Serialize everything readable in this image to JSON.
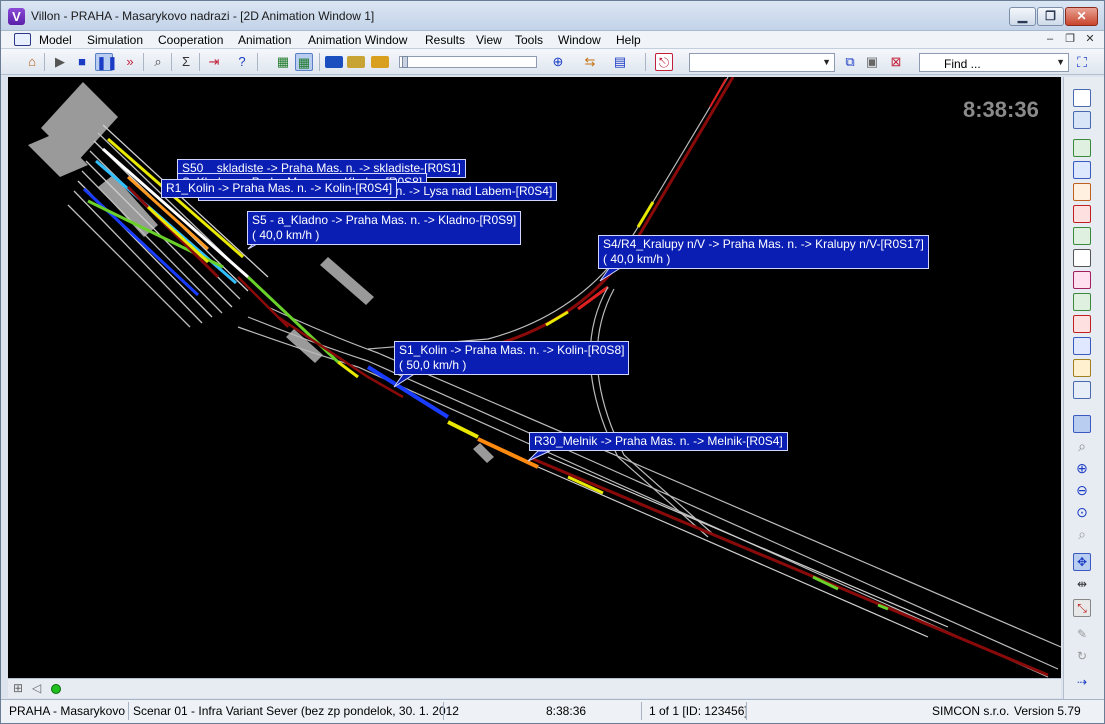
{
  "window": {
    "title": "Villon - PRAHA - Masarykovo nadrazi - [2D Animation Window 1]",
    "app_icon_letter": "V"
  },
  "menu": {
    "items": [
      "Model",
      "Simulation",
      "Cooperation",
      "Animation",
      "Animation Window",
      "Results",
      "View",
      "Tools",
      "Window",
      "Help"
    ]
  },
  "toolbar": {
    "find_placeholder": "Find ...",
    "combo_value": ""
  },
  "canvas": {
    "clock": "8:38:36",
    "background": "#000000",
    "label_color": "#0a1eb3",
    "train_labels": [
      {
        "text": "S50 _ skladiste -> Praha Mas. n. -> skladiste-[R0S1]",
        "speed": ""
      },
      {
        "text": "S_Kladno -> Praha Mas. n. -> Kladno-[R0S8]",
        "speed": ""
      },
      {
        "text": "Os_Lysa nad Labem -> Praha Mas. n. -> Lysa nad Labem-[R0S4]",
        "speed": ""
      },
      {
        "text": "R1_Kolin -> Praha Mas. n. -> Kolin-[R0S4]",
        "speed": ""
      },
      {
        "text": "S5 - a_Kladno -> Praha Mas. n. -> Kladno-[R0S9]",
        "speed": "( 40,0 km/h )"
      },
      {
        "text": "S4/R4_Kralupy n/V -> Praha Mas. n. -> Kralupy n/V-[R0S17]",
        "speed": "( 40,0 km/h )"
      },
      {
        "text": "S1_Kolin -> Praha Mas. n. -> Kolin-[R0S8]",
        "speed": "( 50,0 km/h )"
      },
      {
        "text": "R30_Melnik -> Praha Mas. n. -> Melnik-[R0S4]",
        "speed": ""
      }
    ]
  },
  "status": {
    "station": "PRAHA - Masarykovo",
    "scenario": "Scenar 01 - Infra Variant Sever (bez zp pondelok, 30. 1. 2012",
    "time": "8:38:36",
    "page": "1 of 1 [ID: 123456]",
    "company": "SIMCON s.r.o.",
    "version": "Version 5.79"
  }
}
